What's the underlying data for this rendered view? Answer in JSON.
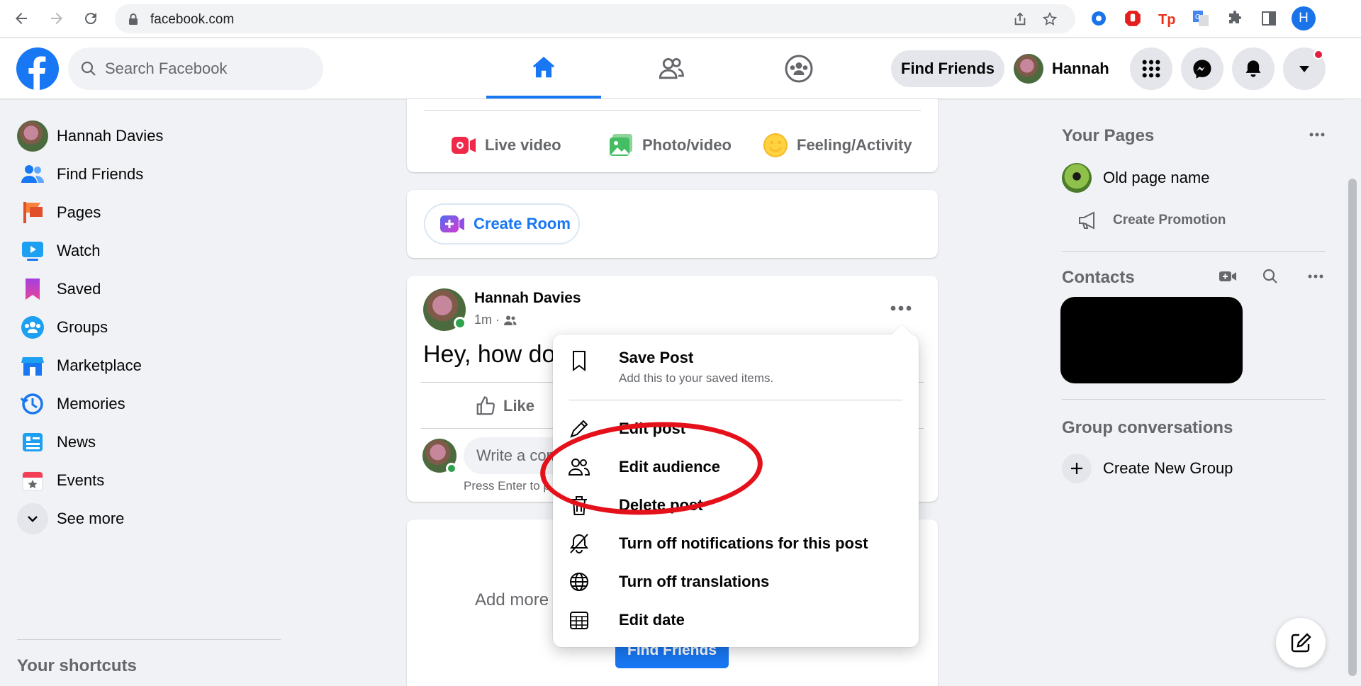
{
  "browser": {
    "url": "facebook.com",
    "profile_letter": "H"
  },
  "header": {
    "search_placeholder": "Search Facebook",
    "find_friends": "Find Friends",
    "user_short": "Hannah"
  },
  "left_sidebar": {
    "items": [
      {
        "label": "Hannah Davies",
        "icon": "avatar"
      },
      {
        "label": "Find Friends",
        "icon": "friends-icon"
      },
      {
        "label": "Pages",
        "icon": "pages-flag-icon"
      },
      {
        "label": "Watch",
        "icon": "watch-play-icon"
      },
      {
        "label": "Saved",
        "icon": "saved-bookmark-icon"
      },
      {
        "label": "Groups",
        "icon": "groups-icon"
      },
      {
        "label": "Marketplace",
        "icon": "marketplace-shop-icon"
      },
      {
        "label": "Memories",
        "icon": "memories-clock-icon"
      },
      {
        "label": "News",
        "icon": "news-icon"
      },
      {
        "label": "Events",
        "icon": "events-calendar-icon"
      },
      {
        "label": "See more",
        "icon": "chevron-down-icon"
      }
    ],
    "shortcuts_title": "Your shortcuts"
  },
  "composer": {
    "actions": [
      "Live video",
      "Photo/video",
      "Feeling/Activity"
    ]
  },
  "room": {
    "label": "Create Room"
  },
  "post": {
    "author": "Hannah Davies",
    "time": "1m ·",
    "text": "Hey, how do",
    "like": "Like",
    "comment_placeholder": "Write a comment...",
    "press_enter": "Press Enter to p"
  },
  "suggest_card": {
    "add_more": "Add more",
    "find_friends": "Find Friends"
  },
  "post_menu": {
    "items": [
      {
        "label": "Save Post",
        "sub": "Add this to your saved items.",
        "icon": "bookmark-icon"
      },
      {
        "label": "Edit post",
        "icon": "pencil-icon"
      },
      {
        "label": "Edit audience",
        "icon": "audience-people-icon"
      },
      {
        "label": "Delete post",
        "icon": "trash-icon"
      },
      {
        "label": "Turn off notifications for this post",
        "icon": "bell-off-icon"
      },
      {
        "label": "Turn off translations",
        "icon": "globe-icon"
      },
      {
        "label": "Edit date",
        "icon": "calendar-grid-icon"
      }
    ]
  },
  "right_sidebar": {
    "your_pages": "Your Pages",
    "page_name": "Old page name",
    "create_promotion": "Create Promotion",
    "contacts": "Contacts",
    "group_conversations": "Group conversations",
    "create_group": "Create New Group"
  },
  "colors": {
    "fb_blue": "#1877f2",
    "annotation_red": "#e4111b",
    "background": "#f0f2f5"
  }
}
